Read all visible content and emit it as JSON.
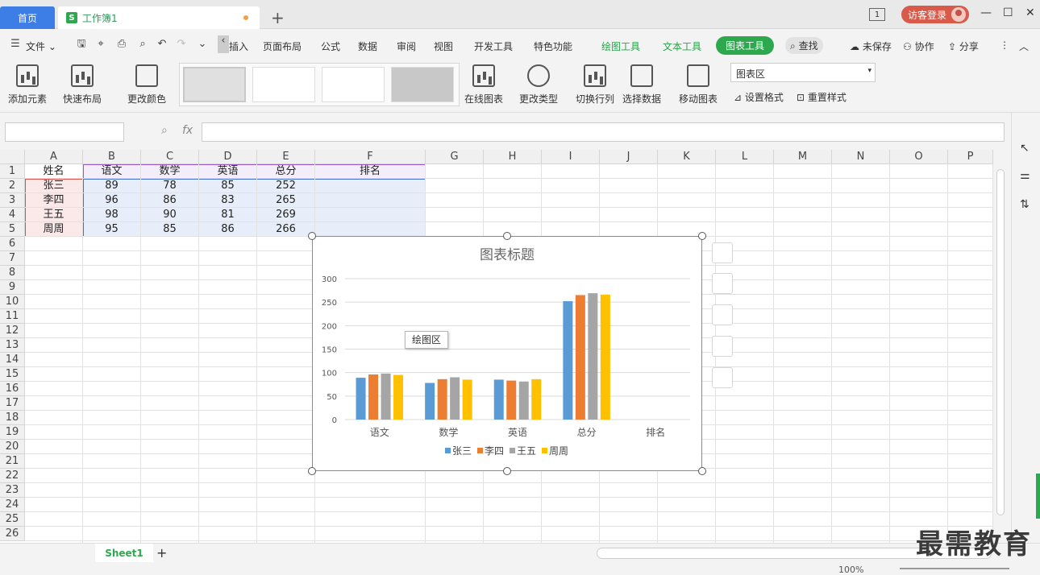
{
  "titlebar": {
    "home_tab": "首页",
    "doc_tab": "工作簿1",
    "new_tab": "+",
    "window_badge": "1",
    "login": "访客登录"
  },
  "menu": {
    "file": "文件",
    "items": [
      "插入",
      "页面布局",
      "公式",
      "数据",
      "审阅",
      "视图",
      "开发工具",
      "特色功能"
    ],
    "context_tabs": [
      "绘图工具",
      "文本工具"
    ],
    "active_tab": "图表工具",
    "search": "查找",
    "unsaved": "未保存",
    "collab": "协作",
    "share": "分享"
  },
  "ribbon": {
    "add_element": "添加元素",
    "quick_layout": "快速布局",
    "change_color": "更改颜色",
    "online_chart": "在线图表",
    "change_type": "更改类型",
    "switch_rowcol": "切换行列",
    "select_data": "选择数据",
    "move_chart": "移动图表",
    "element_select": "图表区",
    "set_format": "设置格式",
    "reset_style": "重置样式"
  },
  "grid": {
    "columns": [
      "A",
      "B",
      "C",
      "D",
      "E",
      "F",
      "G",
      "H",
      "I",
      "J",
      "K",
      "L",
      "M",
      "N",
      "O",
      "P"
    ],
    "rows": [
      "1",
      "2",
      "3",
      "4",
      "5",
      "6",
      "7",
      "8",
      "9",
      "10",
      "11",
      "12",
      "13",
      "14",
      "15",
      "16",
      "17",
      "18",
      "19",
      "20",
      "21",
      "22",
      "23",
      "24",
      "25",
      "26"
    ],
    "table": [
      [
        "姓名",
        "语文",
        "数学",
        "英语",
        "总分",
        "排名"
      ],
      [
        "张三",
        "89",
        "78",
        "85",
        "252",
        ""
      ],
      [
        "李四",
        "96",
        "86",
        "83",
        "265",
        ""
      ],
      [
        "王五",
        "98",
        "90",
        "81",
        "269",
        ""
      ],
      [
        "周周",
        "95",
        "85",
        "86",
        "266",
        ""
      ]
    ]
  },
  "tooltip": "绘图区",
  "chart_data": {
    "type": "bar",
    "title": "图表标题",
    "categories": [
      "语文",
      "数学",
      "英语",
      "总分",
      "排名"
    ],
    "series": [
      {
        "name": "张三",
        "color": "#5b9bd5",
        "values": [
          89,
          78,
          85,
          252,
          0
        ]
      },
      {
        "name": "李四",
        "color": "#ed7d31",
        "values": [
          96,
          86,
          83,
          265,
          0
        ]
      },
      {
        "name": "王五",
        "color": "#a5a5a5",
        "values": [
          98,
          90,
          81,
          269,
          0
        ]
      },
      {
        "name": "周周",
        "color": "#ffc000",
        "values": [
          95,
          85,
          86,
          266,
          0
        ]
      }
    ],
    "yticks": [
      0,
      50,
      100,
      150,
      200,
      250,
      300
    ],
    "ylim": [
      0,
      300
    ],
    "legend": "bottom",
    "grid": true
  },
  "sheet": {
    "name": "Sheet1",
    "add": "+"
  },
  "status": {
    "zoom": "100%"
  },
  "watermark": "最需教育"
}
